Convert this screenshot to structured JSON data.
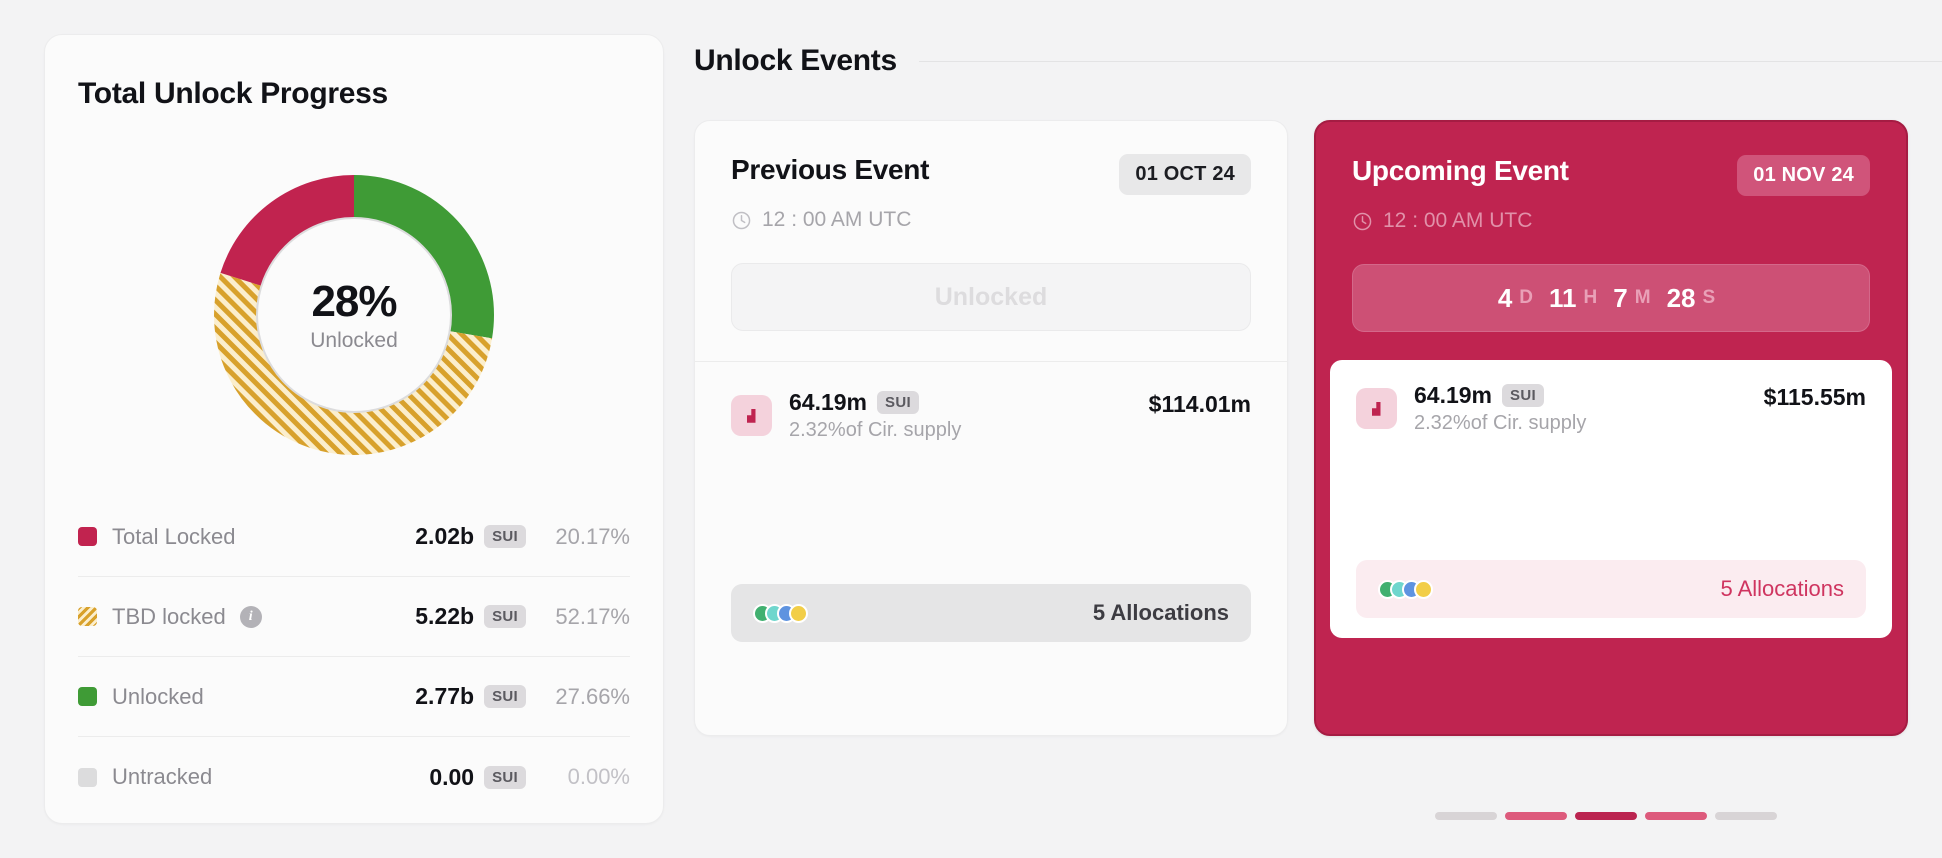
{
  "progress_panel": {
    "title": "Total Unlock Progress",
    "donut": {
      "center_value": "28%",
      "center_label": "Unlocked"
    },
    "legend": [
      {
        "label": "Total Locked",
        "amount": "2.02b",
        "token": "SUI",
        "percent": "20.17%",
        "swatch": "locked-swatch",
        "has_info": false
      },
      {
        "label": "TBD locked",
        "amount": "5.22b",
        "token": "SUI",
        "percent": "52.17%",
        "swatch": "tbd-swatch",
        "has_info": true,
        "info_icon": "info-icon"
      },
      {
        "label": "Unlocked",
        "amount": "2.77b",
        "token": "SUI",
        "percent": "27.66%",
        "swatch": "unlocked-swatch",
        "has_info": false
      },
      {
        "label": "Untracked",
        "amount": "0.00",
        "token": "SUI",
        "percent": "0.00%",
        "swatch": "untracked-swatch",
        "has_info": false
      }
    ]
  },
  "events_panel": {
    "title": "Unlock Events",
    "previous": {
      "name": "Previous Event",
      "date_badge": "01 OCT 24",
      "time": "12 : 00 AM UTC",
      "clock_icon": "clock-icon",
      "status_label": "Unlocked",
      "token_icon": "token-logo-icon",
      "token_amount": "64.19m",
      "token_symbol": "SUI",
      "token_sub": "2.32%of Cir. supply",
      "usd_value": "$114.01m",
      "allocations_label": "5 Allocations",
      "allocation_dots": [
        "#41b070",
        "#6fd6cd",
        "#5e93e0",
        "#f2ce48"
      ]
    },
    "upcoming": {
      "name": "Upcoming Event",
      "date_badge": "01 NOV 24",
      "time": "12 : 00 AM UTC",
      "clock_icon": "clock-icon",
      "countdown": {
        "days_value": "4",
        "days_unit": "D",
        "hours_value": "11",
        "hours_unit": "H",
        "minutes_value": "7",
        "minutes_unit": "M",
        "seconds_value": "28",
        "seconds_unit": "S"
      },
      "token_icon": "token-logo-icon",
      "token_amount": "64.19m",
      "token_symbol": "SUI",
      "token_sub": "2.32%of Cir. supply",
      "usd_value": "$115.55m",
      "allocations_label": "5 Allocations",
      "allocation_dots": [
        "#41b070",
        "#6fd6cd",
        "#5e93e0",
        "#f2ce48"
      ]
    },
    "pagination": [
      {
        "color": "#d8d4d6",
        "active": false
      },
      {
        "color": "#dd5a7c",
        "active": false
      },
      {
        "color": "#bb2450",
        "active": true
      },
      {
        "color": "#dd5a7c",
        "active": false
      },
      {
        "color": "#d8d4d6",
        "active": false
      }
    ]
  },
  "chart_data": {
    "type": "pie",
    "title": "Total Unlock Progress",
    "categories": [
      "Total Locked",
      "TBD locked",
      "Unlocked",
      "Untracked"
    ],
    "values": [
      20.17,
      52.17,
      27.66,
      0.0
    ],
    "amounts": [
      "2.02b",
      "5.22b",
      "2.77b",
      "0.00"
    ],
    "unit": "SUI",
    "colors": [
      "#c1234f",
      "#d8a12c",
      "#3f9b36",
      "#dcdcdd"
    ],
    "center_value": "28%",
    "center_label": "Unlocked",
    "legend_position": "bottom"
  }
}
